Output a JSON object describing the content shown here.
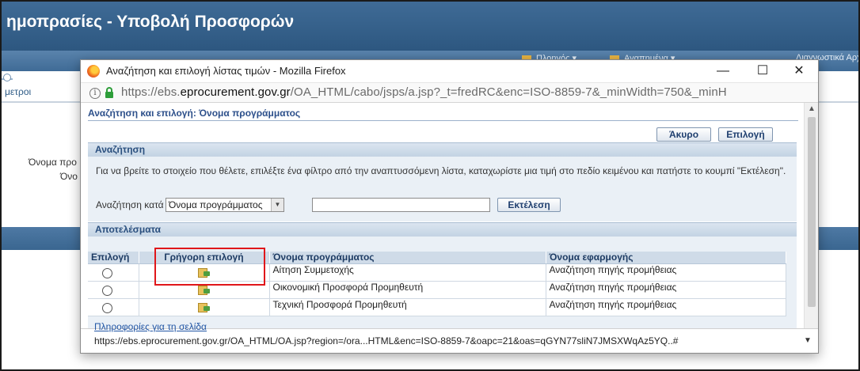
{
  "background_app": {
    "title": "ημοπρασίες - Υποβολή Προσφορών",
    "menu": [
      "Πλοηγός",
      "Αγαπημένα"
    ],
    "menu_diag": "Διαγνωστικά Αρχ",
    "tab_label": "μετροι",
    "field_label_1": "Όνομα προ",
    "field_label_2": "Όνο"
  },
  "popup": {
    "window_title": "Αναζήτηση και επιλογή λίστας τιμών - Mozilla Firefox",
    "window_buttons": {
      "minimize": "—",
      "maximize": "☐",
      "close": "✕"
    },
    "url": {
      "prefix": "https://ebs.",
      "domain": "eprocurement.gov.gr",
      "suffix": "/OA_HTML/cabo/jsps/a.jsp?_t=fredRC&enc=ISO-8859-7&_minWidth=750&_minH"
    },
    "page_title": "Αναζήτηση και επιλογή: Όνομα προγράμματος",
    "buttons": {
      "cancel": "Άκυρο",
      "select": "Επιλογή"
    },
    "search": {
      "header": "Αναζήτηση",
      "help": "Για να βρείτε το στοιχείο που θέλετε, επιλέξτε ένα φίλτρο από την αναπτυσσόμενη λίστα, καταχωρίστε μια τιμή στο πεδίο κειμένου και πατήστε το κουμπί \"Εκτέλεση\".",
      "search_by_label": "Αναζήτηση κατά",
      "selected_filter": "Όνομα προγράμματος",
      "text_value": "",
      "go_button": "Εκτέλεση"
    },
    "results": {
      "header": "Αποτελέσματα",
      "columns": [
        "Επιλογή",
        "Γρήγορη επιλογή",
        "Όνομα προγράμματος",
        "Όνομα εφαρμογής"
      ],
      "rows": [
        {
          "program": "Αίτηση Συμμετοχής",
          "application": "Αναζήτηση πηγής προμήθειας"
        },
        {
          "program": "Οικονομική Προσφορά Προμηθευτή",
          "application": "Αναζήτηση πηγής προμήθειας"
        },
        {
          "program": "Τεχνική Προσφορά Προμηθευτή",
          "application": "Αναζήτηση πηγής προμήθειας"
        }
      ]
    },
    "help_link": "Πληροφορίες για τη σελίδα",
    "status_url": "https://ebs.eprocurement.gov.gr/OA_HTML/OA.jsp?region=/ora...HTML&enc=ISO-8859-7&oapc=21&oas=qGYN77sliN7JMSXWqAz5YQ..#"
  },
  "colors": {
    "header_blue": "#3f6b96",
    "section_header": "#c3d3e3",
    "link_blue": "#2256a5",
    "highlight_red": "#e0161a"
  }
}
